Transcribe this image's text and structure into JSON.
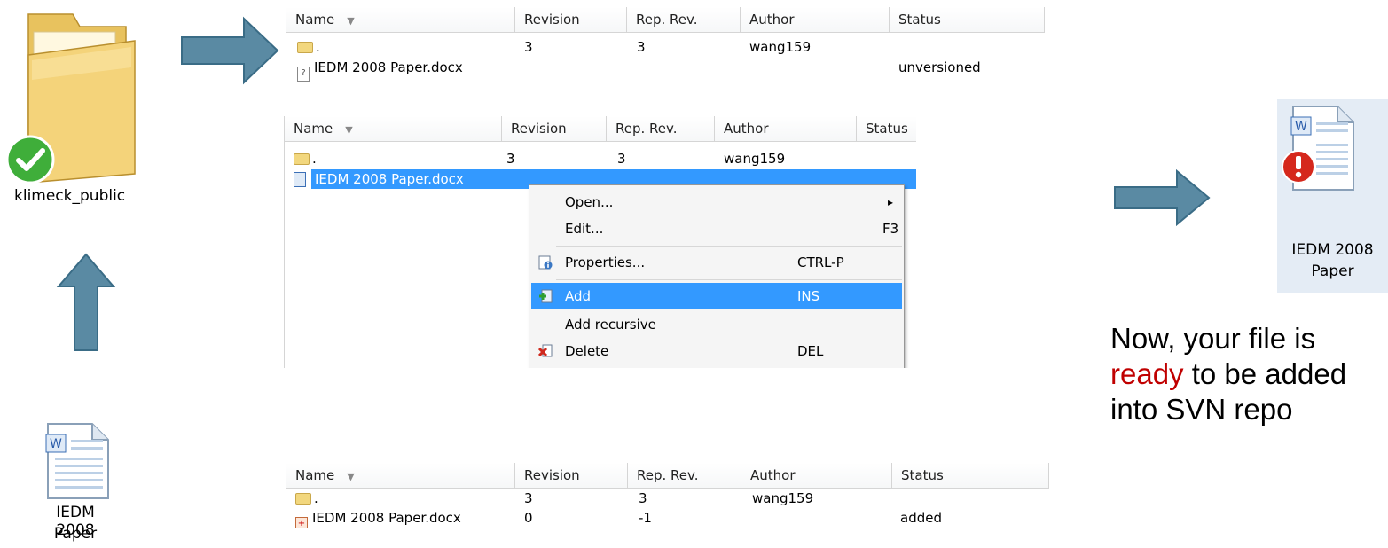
{
  "colors": {
    "arrow_fill": "#5a8aa3",
    "arrow_stroke": "#3a6c86",
    "selection": "#3399ff",
    "highlight_text": "#c00000"
  },
  "left_icons": {
    "folder_label": "klimeck_public",
    "doc_label_line1": "IEDM 2008",
    "doc_label_line2": "Paper"
  },
  "right_icon": {
    "label_line1": "IEDM 2008",
    "label_line2": "Paper"
  },
  "panel1": {
    "headers": [
      "Name",
      "Revision",
      "Rep. Rev.",
      "Author",
      "Status"
    ],
    "rows": [
      {
        "name": ".",
        "revision": "3",
        "rep_rev": "3",
        "author": "wang159",
        "status": ""
      },
      {
        "name": "IEDM 2008 Paper.docx",
        "revision": "",
        "rep_rev": "",
        "author": "",
        "status": "unversioned"
      }
    ]
  },
  "panel2": {
    "headers": [
      "Name",
      "Revision",
      "Rep. Rev.",
      "Author",
      "Status"
    ],
    "rows": [
      {
        "name": ".",
        "revision": "3",
        "rep_rev": "3",
        "author": "wang159"
      },
      {
        "name": "IEDM 2008 Paper.docx"
      }
    ],
    "context_menu": [
      {
        "label": "Open...",
        "shortcut": "",
        "submenu_arrow": "▸"
      },
      {
        "label": "Edit...",
        "shortcut": "F3"
      },
      {
        "label": "Properties...",
        "shortcut": "CTRL-P",
        "icon": "properties-icon"
      },
      {
        "label": "Add",
        "shortcut": "INS",
        "icon": "add-plus-icon"
      },
      {
        "label": "Add recursive",
        "shortcut": ""
      },
      {
        "label": "Delete",
        "shortcut": "DEL",
        "icon": "delete-x-icon"
      }
    ]
  },
  "panel3": {
    "headers": [
      "Name",
      "Revision",
      "Rep. Rev.",
      "Author",
      "Status"
    ],
    "rows": [
      {
        "name": ".",
        "revision": "3",
        "rep_rev": "3",
        "author": "wang159",
        "status": ""
      },
      {
        "name": "IEDM 2008 Paper.docx",
        "revision": "0",
        "rep_rev": "-1",
        "author": "",
        "status": "added"
      }
    ]
  },
  "caption": {
    "line1": "Now, your file is",
    "line2_red": "ready",
    "line2_rest": " to be added",
    "line3": "into SVN repo"
  }
}
